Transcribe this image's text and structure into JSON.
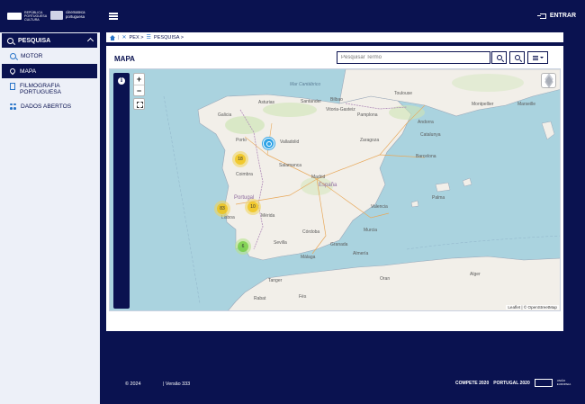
{
  "header": {
    "logo_republica": "REPÚBLICA PORTUGUESA CULTURA",
    "logo_cinemateca": "cinemateca portuguesa",
    "login_label": "ENTRAR"
  },
  "sidebar": {
    "section_label": "PESQUISA",
    "items": [
      {
        "label": "MOTOR",
        "icon": "search-icon"
      },
      {
        "label": "MAPA",
        "icon": "map-pin-icon",
        "active": true
      },
      {
        "label": "FILMOGRAFIA PORTUGUESA",
        "icon": "document-icon"
      },
      {
        "label": "DADOS ABERTOS",
        "icon": "data-dots-icon"
      }
    ]
  },
  "breadcrumb": {
    "items": [
      "PEX >",
      "PESQUISA >"
    ]
  },
  "main": {
    "title": "MAPA",
    "search_placeholder": "Pesquisar Termo"
  },
  "map": {
    "labels": [
      {
        "text": "Mar Cantábrico",
        "cls": "sea"
      },
      {
        "text": "Galicia",
        "cls": ""
      },
      {
        "text": "Asturias",
        "cls": ""
      },
      {
        "text": "Santander",
        "cls": ""
      },
      {
        "text": "Bilbao",
        "cls": ""
      },
      {
        "text": "Toulouse",
        "cls": ""
      },
      {
        "text": "Montpellier",
        "cls": ""
      },
      {
        "text": "Marseille",
        "cls": ""
      },
      {
        "text": "Vitoria-Gasteiz",
        "cls": ""
      },
      {
        "text": "Pamplona",
        "cls": ""
      },
      {
        "text": "Andorra",
        "cls": ""
      },
      {
        "text": "Valladolid",
        "cls": ""
      },
      {
        "text": "Zaragoza",
        "cls": ""
      },
      {
        "text": "Barcelona",
        "cls": ""
      },
      {
        "text": "Catalunya",
        "cls": ""
      },
      {
        "text": "Salamanca",
        "cls": ""
      },
      {
        "text": "Madrid",
        "cls": ""
      },
      {
        "text": "España",
        "cls": "cc"
      },
      {
        "text": "Valencia",
        "cls": ""
      },
      {
        "text": "Palma",
        "cls": ""
      },
      {
        "text": "Coimbra",
        "cls": ""
      },
      {
        "text": "Portugal",
        "cls": "cc"
      },
      {
        "text": "Lisboa",
        "cls": ""
      },
      {
        "text": "Mérida",
        "cls": ""
      },
      {
        "text": "Córdoba",
        "cls": ""
      },
      {
        "text": "Sevilla",
        "cls": ""
      },
      {
        "text": "Granada",
        "cls": ""
      },
      {
        "text": "Málaga",
        "cls": ""
      },
      {
        "text": "Almería",
        "cls": ""
      },
      {
        "text": "Murcia",
        "cls": ""
      },
      {
        "text": "Alger",
        "cls": ""
      },
      {
        "text": "Oran",
        "cls": ""
      },
      {
        "text": "Tanger",
        "cls": ""
      },
      {
        "text": "Rabat",
        "cls": ""
      },
      {
        "text": "Fès",
        "cls": ""
      },
      {
        "text": "Porto",
        "cls": ""
      }
    ],
    "clusters": [
      {
        "count": "18",
        "color": "yellow"
      },
      {
        "count": "10",
        "color": "yellow"
      },
      {
        "count": "83",
        "color": "yellow"
      },
      {
        "count": "6",
        "color": "green"
      }
    ],
    "attribution": "Leaflet | © OpenStreetMap"
  },
  "footer": {
    "copyright": "© 2024",
    "version": "| Versão 333",
    "logo_compete": "COMPETE 2020",
    "logo_portugal2020": "PORTUGAL 2020",
    "logo_eu": "UNIÃO EUROPEIA"
  },
  "colors": {
    "navy": "#0a1250",
    "accent_blue": "#2874c8",
    "sea": "#aad3df",
    "land": "#f2efe9"
  }
}
